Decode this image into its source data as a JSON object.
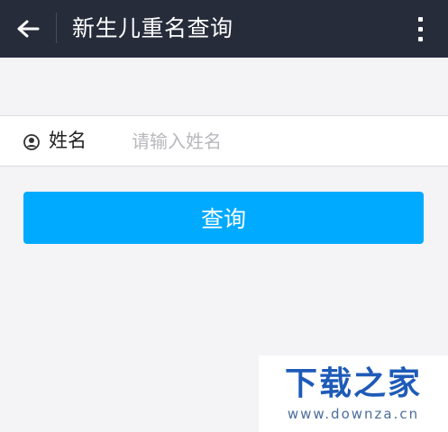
{
  "header": {
    "title": "新生儿重名查询",
    "back_icon": "arrow-left-icon",
    "menu_icon": "more-vertical-icon"
  },
  "form": {
    "field_label": "姓名",
    "field_icon": "person-icon",
    "input_value": "",
    "input_placeholder": "请输入姓名",
    "submit_label": "查询"
  },
  "watermark": {
    "logo": "下载之家",
    "url": "www.downza.cn"
  },
  "colors": {
    "header_bg": "#272c3b",
    "page_bg": "#f4f3f6",
    "button_bg": "#00aaff",
    "watermark_text": "#1e5bb8"
  }
}
